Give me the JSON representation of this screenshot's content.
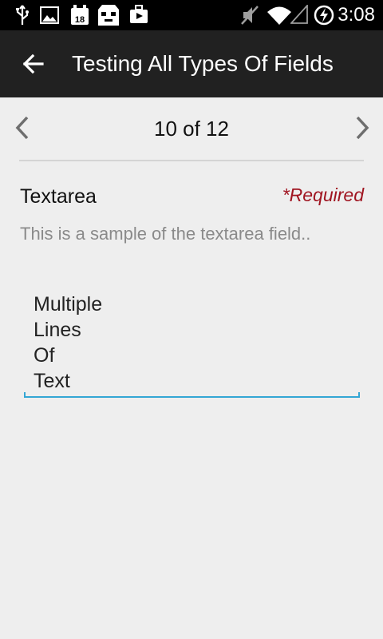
{
  "status_bar": {
    "time": "3:08",
    "icons": [
      "usb-icon",
      "gallery-icon",
      "calendar-icon",
      "android-icon",
      "briefcase-icon",
      "mute-icon",
      "wifi-icon",
      "signal-icon",
      "battery-charging-icon"
    ]
  },
  "action_bar": {
    "title": "Testing All Types Of Fields",
    "back_icon": "arrow-back-icon"
  },
  "pager": {
    "count": "10 of 12",
    "prev_icon": "chevron-left-icon",
    "next_icon": "chevron-right-icon"
  },
  "field": {
    "label": "Textarea",
    "required": "*Required",
    "help": "This is a sample of the textarea field..",
    "value_lines": [
      "Multiple",
      "Lines",
      "Of",
      "Text"
    ]
  },
  "colors": {
    "status_bar": "#000000",
    "action_bar": "#212121",
    "background": "#eeeeee",
    "required": "#a01521",
    "accent": "#33a6d4"
  }
}
